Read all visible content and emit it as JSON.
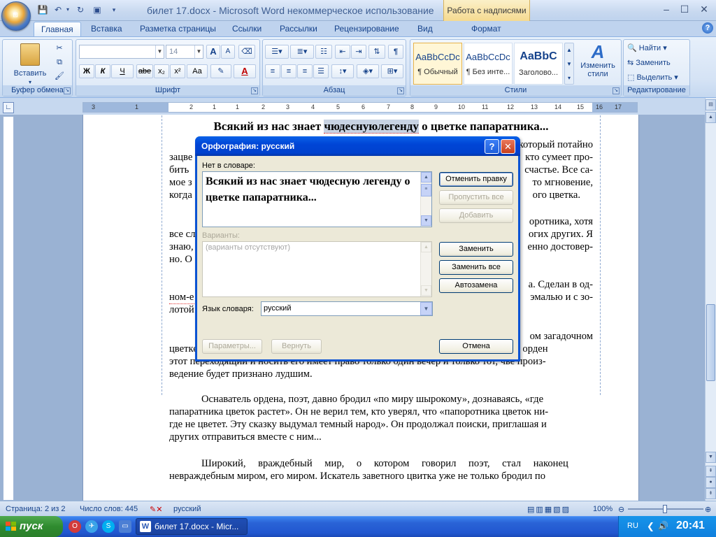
{
  "window": {
    "title": "билет 17.docx - Microsoft Word некоммерческое использование",
    "context_tab_group": "Работа с надписями",
    "minimize": "–",
    "maximize": "☐",
    "close": "✕"
  },
  "tabs": [
    {
      "label": "Главная",
      "active": true
    },
    {
      "label": "Вставка"
    },
    {
      "label": "Разметка страницы"
    },
    {
      "label": "Ссылки"
    },
    {
      "label": "Рассылки"
    },
    {
      "label": "Рецензирование"
    },
    {
      "label": "Вид"
    },
    {
      "label": "Формат"
    }
  ],
  "ribbon": {
    "clipboard": {
      "label": "Буфер обмена",
      "paste": "Вставить"
    },
    "font": {
      "label": "Шрифт",
      "font_name": "",
      "font_size": "14",
      "bold": "Ж",
      "italic": "К",
      "underline": "Ч",
      "strike": "abe",
      "subscript": "x₂",
      "superscript": "x²",
      "case": "Aa",
      "grow": "A",
      "shrink": "A",
      "font_color": "A"
    },
    "paragraph": {
      "label": "Абзац",
      "show_marks": "¶"
    },
    "styles": {
      "label": "Стили",
      "items": [
        {
          "sample": "AaBbCcDc",
          "name": "¶ Обычный"
        },
        {
          "sample": "AaBbCcDc",
          "name": "¶ Без инте..."
        },
        {
          "sample": "AaBbC",
          "name": "Заголово..."
        }
      ],
      "change_styles": "Изменить стили"
    },
    "editing": {
      "label": "Редактирование",
      "find": "Найти",
      "replace": "Заменить",
      "select": "Выделить"
    }
  },
  "ruler": {
    "numbers": [
      "3",
      "1",
      "2",
      "1",
      "1",
      "2",
      "3",
      "4",
      "5",
      "6",
      "7",
      "8",
      "9",
      "10",
      "11",
      "12",
      "13",
      "14",
      "15",
      "16",
      "17"
    ]
  },
  "document": {
    "heading_pre": "Всякий из нас знает ",
    "heading_hl": "чюдеснуюлегенду",
    "heading_post": " о цветке папаратника...",
    "p1_line1_right": "который потайно",
    "p1_line2_left": "зацве",
    "p1_line2_right": "кто сумеет про-",
    "p1_line3_left": "бить",
    "p1_line3_right": "счастье. Все са-",
    "p1_line4_left": "мое з",
    "p1_line4_right": "то мгновение,",
    "p1_line5_left": "когда",
    "p1_line5_right": "ого цветка.",
    "p2_line1_right": "оротника, хотя",
    "p2_line2_left": "все сл",
    "p2_line2_right": "огих других. Я",
    "p2_line3_left": "знаю,",
    "p2_line3_right": "енно достовер-",
    "p2_line4_left": "но. О",
    "p3_line1_right": "а. Сделан в од-",
    "p3_line2_left": "ном-е",
    "p3_line2_right": "эмалью и с зо-",
    "p3_line3_left": "лотой",
    "p4_line1_right": "ом загадочном",
    "p4_line2": "цветке. Своеобразен статут ордена. Самый главный параграф статута гласит, что орден",
    "p4_line3": "этот переходящий и носить его имеет право только один вечер и только тот, чье произ-",
    "p4_line4": "ведение будет признано лудшим.",
    "p5_line1": "Оснаватель ордена, поэт, давно бродил «по миру шырокому», дознаваясь, «где",
    "p5_line2": "папаратника цветок растет». Он не верил тем, кто уверял, что «папоротника цветок ни-",
    "p5_line3": "где не цветет. Эту сказку выдумал темный народ». Он продолжал поиски, приглашая и",
    "p5_line4": "других отправиться вместе с ним...",
    "p6_line1": "Широкий, враждебный мир, о котором говорил поэт, стал наконец",
    "p6_line2": "невраждебным миром, его миром. Искатель заветного цвитка уже не только бродил по"
  },
  "dialog": {
    "title": "Орфография: русский",
    "help": "?",
    "close": "✕",
    "not_in_dict_label": "Нет в словаре:",
    "not_in_dict_text": "Всякий из нас знает чюдесную легенду о цветке папаратника...",
    "suggestions_label": "Варианты:",
    "suggestions_empty": "(варианты отсутствуют)",
    "lang_label": "Язык словаря:",
    "lang_value": "русский",
    "btn_undo": "Отменить правку",
    "btn_skip_all": "Пропустить все",
    "btn_add": "Добавить",
    "btn_replace": "Заменить",
    "btn_replace_all": "Заменить все",
    "btn_autocorrect": "Автозамена",
    "btn_options": "Параметры...",
    "btn_back": "Вернуть",
    "btn_cancel": "Отмена"
  },
  "status": {
    "page": "Страница: 2 из 2",
    "words": "Число слов: 445",
    "lang": "русский",
    "zoom": "100%"
  },
  "taskbar": {
    "start": "пуск",
    "task_word": "билет 17.docx - Micr...",
    "lang": "RU",
    "clock": "20:41"
  },
  "colors": {
    "accent": "#0b53d3",
    "ribbon": "#dce8f7",
    "taskbar": "#2157d0"
  }
}
